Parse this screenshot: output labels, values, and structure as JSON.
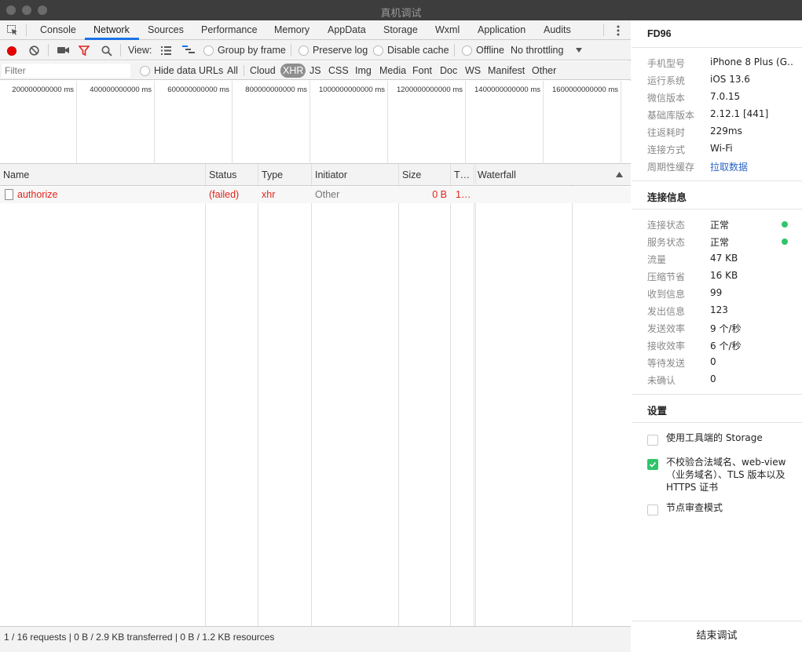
{
  "window": {
    "title": "真机调试"
  },
  "tabs": [
    "Console",
    "Network",
    "Sources",
    "Performance",
    "Memory",
    "AppData",
    "Storage",
    "Wxml",
    "Application",
    "Audits"
  ],
  "active_tab": "Network",
  "toolbar": {
    "view_label": "View:",
    "group_by_frame": "Group by frame",
    "preserve_log": "Preserve log",
    "disable_cache": "Disable cache",
    "offline": "Offline",
    "throttling": "No throttling"
  },
  "filter": {
    "placeholder": "Filter",
    "hide_data_urls": "Hide data URLs",
    "types": [
      "All",
      "Cloud",
      "XHR",
      "JS",
      "CSS",
      "Img",
      "Media",
      "Font",
      "Doc",
      "WS",
      "Manifest",
      "Other"
    ],
    "active_type": "XHR"
  },
  "overview_ticks": [
    "200000000000 ms",
    "400000000000 ms",
    "600000000000 ms",
    "800000000000 ms",
    "1000000000000 ms",
    "1200000000000 ms",
    "1400000000000 ms",
    "1600000000000 ms"
  ],
  "columns": [
    "Name",
    "Status",
    "Type",
    "Initiator",
    "Size",
    "T…",
    "Waterfall"
  ],
  "requests": [
    {
      "name": "authorize",
      "status": "(failed)",
      "type": "xhr",
      "initiator": "Other",
      "size": "0 B",
      "time": "1…"
    }
  ],
  "status_bar": "1 / 16 requests | 0 B / 2.9 KB transferred | 0 B / 1.2 KB resources",
  "panel": {
    "device_id": "FD96",
    "device_info": [
      {
        "key": "手机型号",
        "value": "iPhone 8 Plus (G…"
      },
      {
        "key": "运行系统",
        "value": "iOS 13.6"
      },
      {
        "key": "微信版本",
        "value": "7.0.15"
      },
      {
        "key": "基础库版本",
        "value": "2.12.1 [441]"
      },
      {
        "key": "往返耗时",
        "value": "229ms"
      },
      {
        "key": "连接方式",
        "value": "Wi-Fi"
      },
      {
        "key": "周期性缓存",
        "value": "拉取数据"
      }
    ],
    "connection_title": "连接信息",
    "connection_info": [
      {
        "key": "连接状态",
        "value": "正常"
      },
      {
        "key": "服务状态",
        "value": "正常"
      },
      {
        "key": "流量",
        "value": "47 KB"
      },
      {
        "key": "压缩节省",
        "value": "16 KB"
      },
      {
        "key": "收到信息",
        "value": "99"
      },
      {
        "key": "发出信息",
        "value": "123"
      },
      {
        "key": "发送效率",
        "value": "9 个/秒"
      },
      {
        "key": "接收效率",
        "value": "6 个/秒"
      },
      {
        "key": "等待发送",
        "value": "0"
      },
      {
        "key": "未确认",
        "value": "0"
      }
    ],
    "settings_title": "设置",
    "settings": [
      {
        "label": "使用工具端的 Storage",
        "checked": false
      },
      {
        "label": "不校验合法域名、web-view（业务域名）、TLS 版本以及 HTTPS 证书",
        "checked": true
      },
      {
        "label": "节点审查模式",
        "checked": false
      }
    ],
    "end_button": "结束调试",
    "colors": {
      "ok_dot": "#30c46a",
      "link": "#2b64c4",
      "error": "#e0251c",
      "accent": "#1a73e8"
    }
  }
}
